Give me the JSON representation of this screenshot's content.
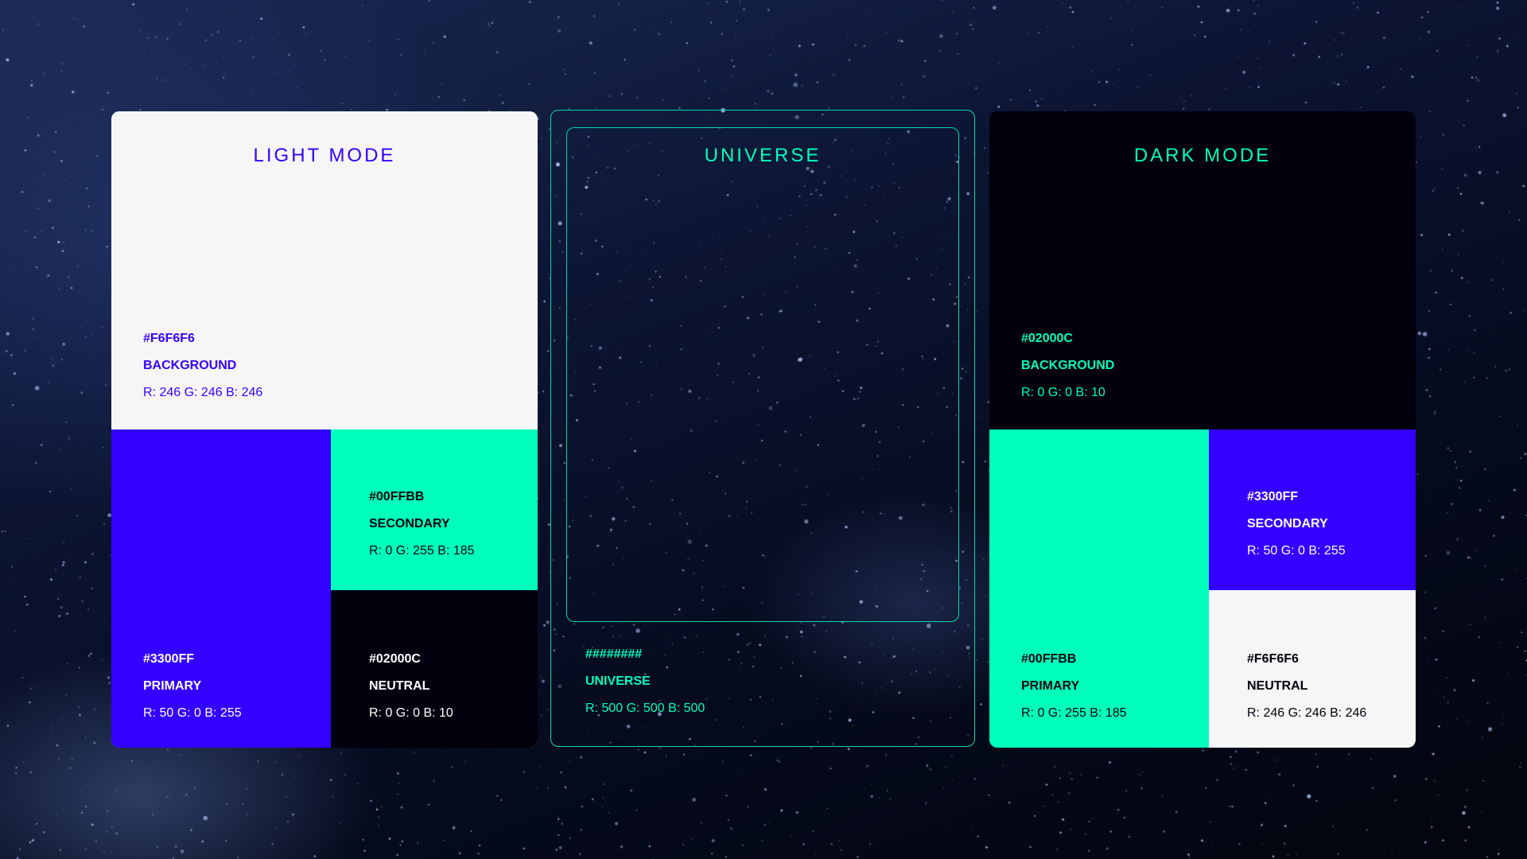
{
  "light_mode": {
    "title": "LIGHT MODE",
    "background": {
      "hex": "#F6F6F6",
      "name": "BACKGROUND",
      "rgb": "R: 246  G: 246  B: 246"
    },
    "primary": {
      "hex": "#3300FF",
      "name": "PRIMARY",
      "rgb": "R: 50  G: 0  B: 255"
    },
    "secondary": {
      "hex": "#00FFBB",
      "name": "SECONDARY",
      "rgb": "R: 0  G: 255  B: 185"
    },
    "neutral": {
      "hex": "#02000C",
      "name": "NEUTRAL",
      "rgb": "R: 0  G: 0  B: 10"
    }
  },
  "universe": {
    "title": "UNIVERSE",
    "hex": "########",
    "name": "UNIVERSE",
    "rgb": "R: 500  G: 500  B: 500",
    "accent": "#00FFBB"
  },
  "dark_mode": {
    "title": "DARK MODE",
    "background": {
      "hex": "#02000C",
      "name": "BACKGROUND",
      "rgb": "R: 0  G: 0  B: 10"
    },
    "primary": {
      "hex": "#00FFBB",
      "name": "PRIMARY",
      "rgb": "R: 0  G: 255  B: 185"
    },
    "secondary": {
      "hex": "#3300FF",
      "name": "SECONDARY",
      "rgb": "R: 50  G: 0  B: 255"
    },
    "neutral": {
      "hex": "#F6F6F6",
      "name": "NEUTRAL",
      "rgb": "R: 246  G: 246  B: 246"
    }
  }
}
